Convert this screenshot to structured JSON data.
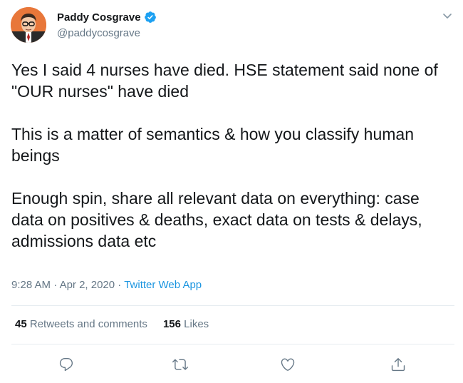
{
  "user": {
    "display_name": "Paddy Cosgrave",
    "handle": "@paddycosgrave",
    "verified": true
  },
  "tweet": {
    "paragraphs": [
      "Yes I said 4 nurses have died. HSE statement said none of \"OUR nurses\" have died",
      "This is a matter of semantics & how you classify human beings",
      "Enough spin, share all relevant data on everything: case data on positives & deaths, exact data on tests & delays, admissions data etc"
    ],
    "time": "9:28 AM",
    "separator": "·",
    "date": "Apr 2, 2020",
    "source": "Twitter Web App"
  },
  "stats": {
    "retweets_count": "45",
    "retweets_label": "Retweets and comments",
    "likes_count": "156",
    "likes_label": "Likes"
  },
  "icons": {
    "reply": "reply-icon",
    "retweet": "retweet-icon",
    "like": "heart-icon",
    "share": "share-icon",
    "more": "chevron-down-icon",
    "verified": "verified-badge-icon"
  },
  "colors": {
    "link": "#1b95e0",
    "muted": "#657786",
    "text": "#14171a",
    "verified": "#1da1f2"
  }
}
